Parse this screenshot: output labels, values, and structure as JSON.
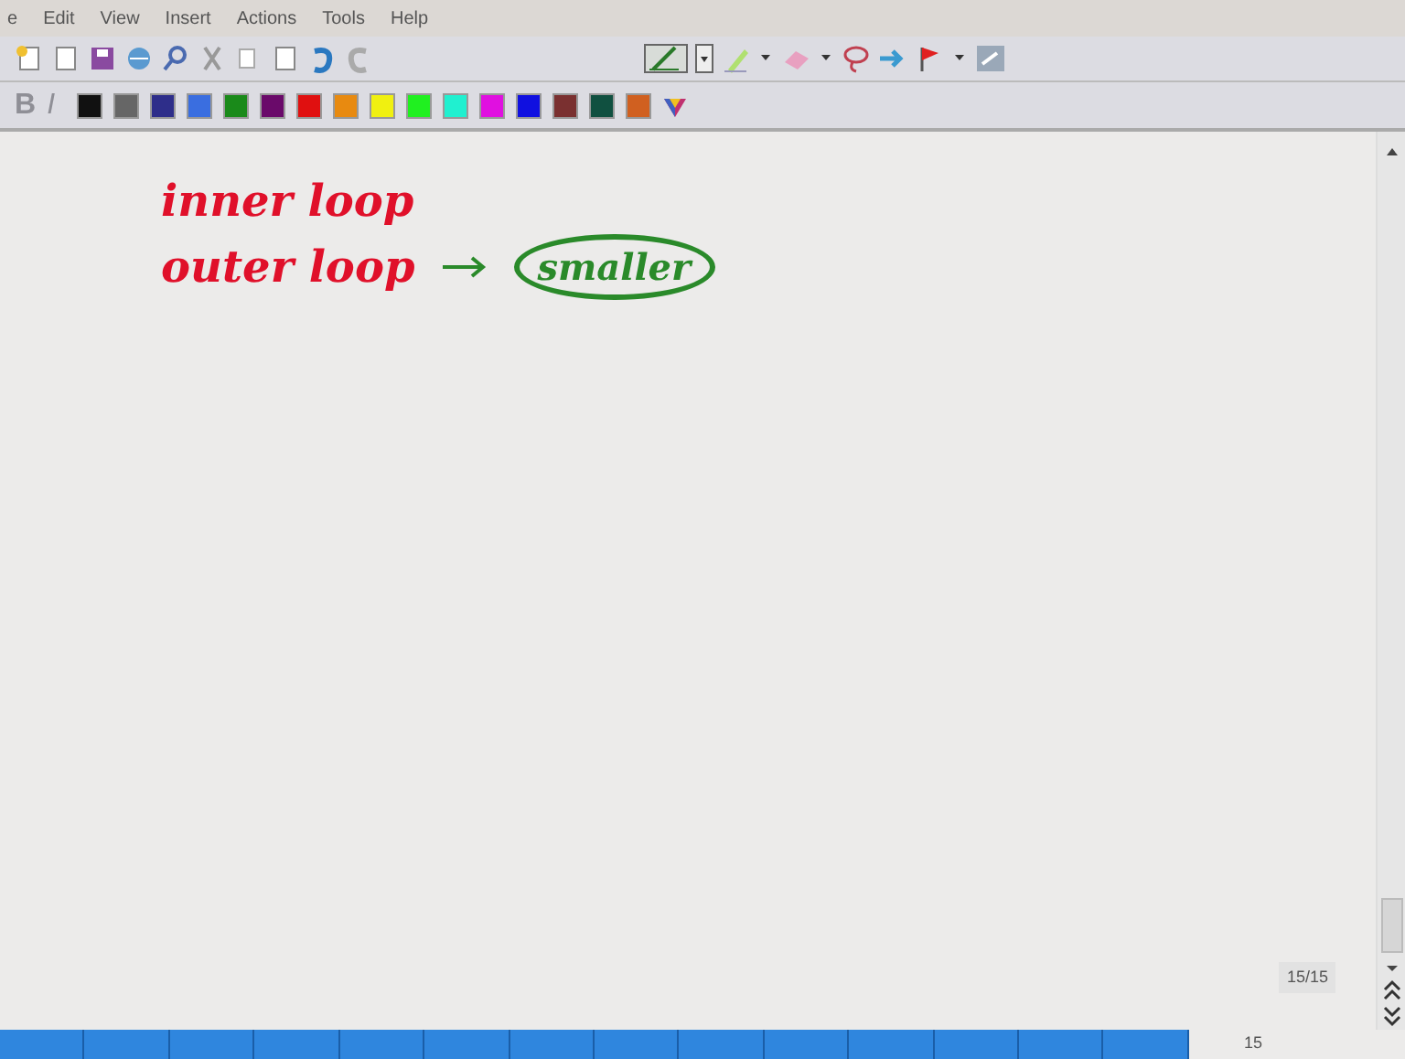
{
  "menu": [
    "e",
    "Edit",
    "View",
    "Insert",
    "Actions",
    "Tools",
    "Help"
  ],
  "format_buttons": [
    {
      "label": "B",
      "disabled": true
    },
    {
      "label": "I",
      "disabled": true
    }
  ],
  "palette": [
    {
      "color": "#111111"
    },
    {
      "color": "#666666"
    },
    {
      "color": "#2e2e8a"
    },
    {
      "color": "#3a6ee0"
    },
    {
      "color": "#1a8a1a"
    },
    {
      "color": "#6a0a6a"
    },
    {
      "color": "#e01010"
    },
    {
      "color": "#e88a10"
    },
    {
      "color": "#f0f010"
    },
    {
      "color": "#20f020"
    },
    {
      "color": "#20f0d0"
    },
    {
      "color": "#e010e0"
    },
    {
      "color": "#1010e0"
    },
    {
      "color": "#7a3030"
    },
    {
      "color": "#105040"
    },
    {
      "color": "#d06020"
    }
  ],
  "ink": [
    {
      "text": "inner loop",
      "color": "#e0102a",
      "circled": false,
      "arrow": false
    },
    {
      "text": "outer loop",
      "color": "#e0102a",
      "circled": false,
      "arrow": true
    },
    {
      "text": "smaller",
      "color": "#2a8a2a",
      "circled": true,
      "arrow": false
    }
  ],
  "page_counter": "15/15",
  "page_number": "15"
}
